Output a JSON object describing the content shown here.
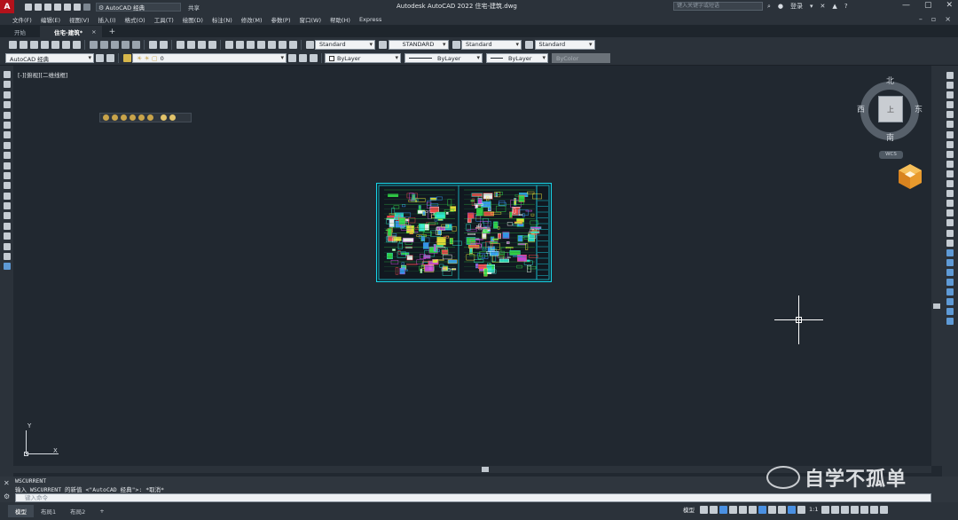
{
  "titlebar": {
    "app_logo": "A",
    "workspace": "AutoCAD 经典",
    "share": "共享",
    "title": "Autodesk AutoCAD 2022    住宅-建筑.dwg",
    "search_placeholder": "键入关键字或短语",
    "login": "登录"
  },
  "menu": [
    "文件(F)",
    "编辑(E)",
    "视图(V)",
    "插入(I)",
    "格式(O)",
    "工具(T)",
    "绘图(D)",
    "标注(N)",
    "修改(M)",
    "参数(P)",
    "窗口(W)",
    "帮助(H)",
    "Express"
  ],
  "tabs": {
    "start": "开始",
    "active": "住宅-建筑*",
    "close": "×",
    "add": "+"
  },
  "toolbar1": {
    "text_style": "Standard",
    "dim_style": "STANDARD",
    "table_style": "Standard",
    "mleader_style": "Standard"
  },
  "toolbar2": {
    "workspace": "AutoCAD 经典",
    "layer": "0",
    "color": "ByLayer",
    "linetype": "ByLayer",
    "lineweight": "ByLayer",
    "plotstyle": "ByColor"
  },
  "viewport": {
    "label": "[-][俯视][二维线框]"
  },
  "viewcube": {
    "north": "北",
    "south": "南",
    "east": "东",
    "west": "西",
    "face": "上",
    "wcs": "WCS"
  },
  "ucs": {
    "x": "X",
    "y": "Y"
  },
  "command": {
    "history1": "WSCURRENT",
    "history2": "输入 WSCURRENT 的新值 <\"AutoCAD 经典\">: *取消*",
    "placeholder": "键入命令"
  },
  "status": {
    "layouts": [
      "模型",
      "布局1",
      "布局2"
    ],
    "add_layout": "+",
    "model": "模型",
    "scale": "1:1"
  },
  "watermark": {
    "text": "自学不孤单"
  },
  "colors": {
    "canvas": "#212830",
    "chrome": "#2b323a",
    "accent": "#4a90e2",
    "brand": "#b3121b"
  }
}
